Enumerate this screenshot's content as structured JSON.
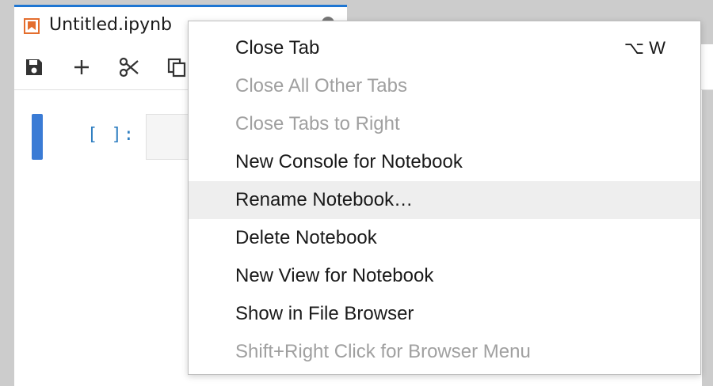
{
  "tab": {
    "title": "Untitled.ipynb",
    "icon": "notebook-icon"
  },
  "toolbar": {
    "buttons": [
      "save-icon",
      "add-icon",
      "cut-icon",
      "copy-icon"
    ]
  },
  "cell": {
    "prompt": "[ ]:",
    "content": ""
  },
  "menu": {
    "items": [
      {
        "label": "Close Tab",
        "shortcut": "⌥ W",
        "enabled": true
      },
      {
        "label": "Close All Other Tabs",
        "shortcut": "",
        "enabled": false
      },
      {
        "label": "Close Tabs to Right",
        "shortcut": "",
        "enabled": false
      },
      {
        "label": "New Console for Notebook",
        "shortcut": "",
        "enabled": true
      },
      {
        "label": "Rename Notebook…",
        "shortcut": "",
        "enabled": true,
        "highlighted": true
      },
      {
        "label": "Delete Notebook",
        "shortcut": "",
        "enabled": true
      },
      {
        "label": "New View for Notebook",
        "shortcut": "",
        "enabled": true
      },
      {
        "label": "Show in File Browser",
        "shortcut": "",
        "enabled": true
      },
      {
        "label": "Shift+Right Click for Browser Menu",
        "shortcut": "",
        "enabled": false
      }
    ]
  },
  "colors": {
    "accent": "#1f76d2",
    "notebook_icon": "#e46e2e",
    "prompt": "#307fc1",
    "disabled_text": "#a0a0a0",
    "highlight_bg": "#eeeeee"
  }
}
